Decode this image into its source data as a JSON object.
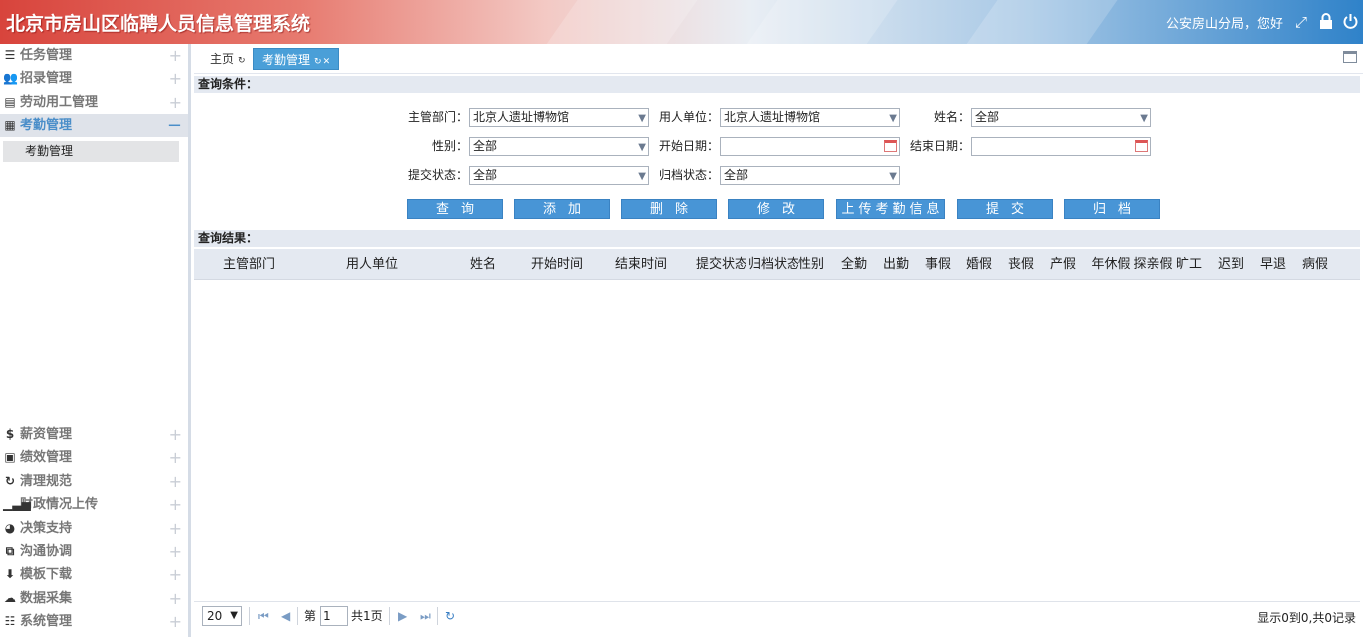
{
  "header": {
    "title": "北京市房山区临聘人员信息管理系统",
    "greeting": "公安房山分局，您好"
  },
  "sidebar": {
    "top_items": [
      {
        "label": "任务管理",
        "icon": "list-icon"
      },
      {
        "label": "招录管理",
        "icon": "users-icon"
      },
      {
        "label": "劳动用工管理",
        "icon": "document-icon"
      },
      {
        "label": "考勤管理",
        "icon": "calendar-icon",
        "active": true
      }
    ],
    "sub_item": "考勤管理",
    "bottom_items": [
      {
        "label": "薪资管理",
        "icon": "dollar-icon"
      },
      {
        "label": "绩效管理",
        "icon": "clipboard-icon"
      },
      {
        "label": "清理规范",
        "icon": "refresh-icon"
      },
      {
        "label": "财政情况上传",
        "icon": "bar-chart-icon"
      },
      {
        "label": "决策支持",
        "icon": "pie-chart-icon"
      },
      {
        "label": "沟通协调",
        "icon": "copy-icon"
      },
      {
        "label": "模板下载",
        "icon": "download-icon"
      },
      {
        "label": "数据采集",
        "icon": "cloud-icon"
      },
      {
        "label": "系统管理",
        "icon": "sliders-icon"
      }
    ]
  },
  "tabs": {
    "home": "主页",
    "current": "考勤管理"
  },
  "query": {
    "section_title": "查询条件：",
    "dept_label": "主管部门：",
    "dept_value": "北京人遗址博物馆",
    "unit_label": "用人单位：",
    "unit_value": "北京人遗址博物馆",
    "name_label": "姓名：",
    "name_value": "全部",
    "gender_label": "性别：",
    "gender_value": "全部",
    "start_label": "开始日期：",
    "start_value": "",
    "end_label": "结束日期：",
    "end_value": "",
    "submit_status_label": "提交状态：",
    "submit_status_value": "全部",
    "archive_status_label": "归档状态：",
    "archive_status_value": "全部"
  },
  "buttons": {
    "search": "查询",
    "add": "添加",
    "delete": "删除",
    "edit": "修改",
    "upload": "上传考勤信息",
    "submit": "提交",
    "archive": "归档"
  },
  "results": {
    "section_title": "查询结果：",
    "columns": [
      "主管部门",
      "用人单位",
      "姓名",
      "开始时间",
      "结束时间",
      "提交状态",
      "归档状态",
      "性别",
      "全勤",
      "出勤",
      "事假",
      "婚假",
      "丧假",
      "产假",
      "年休假",
      "探亲假",
      "旷工",
      "迟到",
      "早退",
      "病假"
    ]
  },
  "pager": {
    "page_size": "20",
    "page_prefix": "第",
    "page_number": "1",
    "page_total": "共1页",
    "status": "显示0到0,共0记录"
  }
}
